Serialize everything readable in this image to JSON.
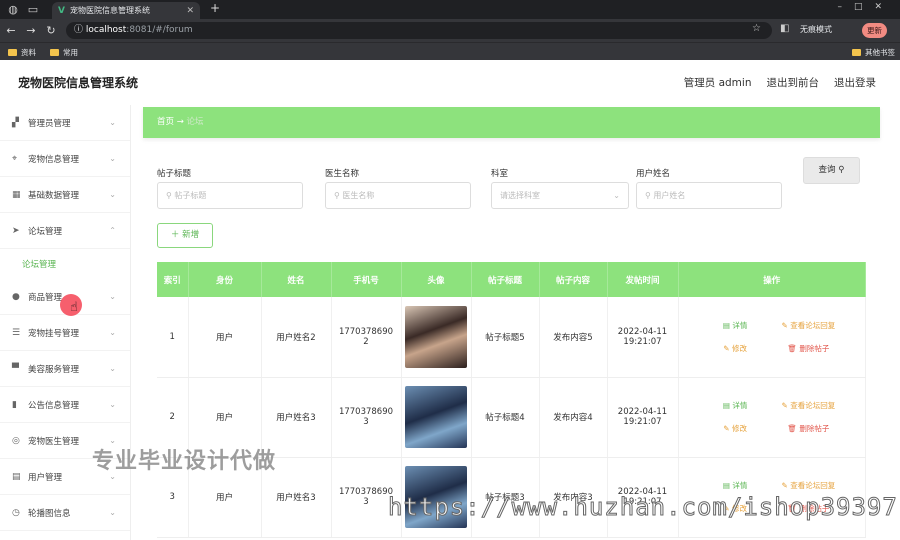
{
  "browser": {
    "tab_title": "宠物医院信息管理系统",
    "tab_favicon": "V",
    "url_host": "localhost",
    "url_path": ":8081/#/forum",
    "profile_label": "无痕模式",
    "update_label": "更新",
    "bookmarks": [
      "资料",
      "常用"
    ],
    "other_bookmarks": "其他书签"
  },
  "header": {
    "title": "宠物医院信息管理系统",
    "user": "管理员 admin",
    "back_front": "退出到前台",
    "logout": "退出登录"
  },
  "sidebar": {
    "items": [
      {
        "label": "管理员管理",
        "icon": "users-icon"
      },
      {
        "label": "宠物信息管理",
        "icon": "pet-icon"
      },
      {
        "label": "基础数据管理",
        "icon": "grid-icon"
      },
      {
        "label": "论坛管理",
        "icon": "send-icon"
      },
      {
        "label": "商品管理",
        "icon": "user-icon"
      },
      {
        "label": "宠物挂号管理",
        "icon": "list-icon"
      },
      {
        "label": "美容服务管理",
        "icon": "service-icon"
      },
      {
        "label": "公告信息管理",
        "icon": "bar-chart-icon"
      },
      {
        "label": "宠物医生管理",
        "icon": "compass-icon"
      },
      {
        "label": "用户管理",
        "icon": "id-card-icon"
      },
      {
        "label": "轮播图信息",
        "icon": "clock-icon"
      }
    ],
    "sub_item": "论坛管理"
  },
  "breadcrumb": {
    "home": "首页",
    "current": "论坛"
  },
  "filters": {
    "title_label": "帖子标题",
    "title_ph": "帖子标题",
    "doctor_label": "医生名称",
    "doctor_ph": "医生名称",
    "dept_label": "科室",
    "dept_ph": "请选择科室",
    "user_label": "用户姓名",
    "user_ph": "用户姓名",
    "query": "查询",
    "add": "新增"
  },
  "table": {
    "headers": [
      "索引",
      "身份",
      "姓名",
      "手机号",
      "头像",
      "帖子标题",
      "帖子内容",
      "发帖时间",
      "操作"
    ],
    "rows": [
      {
        "idx": "1",
        "role": "用户",
        "name": "用户姓名2",
        "phone": "17703786902",
        "title": "帖子标题5",
        "content": "发布内容5",
        "time": "2022-04-11 19:21:07"
      },
      {
        "idx": "2",
        "role": "用户",
        "name": "用户姓名3",
        "phone": "17703786903",
        "title": "帖子标题4",
        "content": "发布内容4",
        "time": "2022-04-11 19:21:07"
      },
      {
        "idx": "3",
        "role": "用户",
        "name": "用户姓名3",
        "phone": "17703786903",
        "title": "帖子标题3",
        "content": "发布内容3",
        "time": "2022-04-11 19:21:07"
      }
    ],
    "ops": {
      "detail": "详情",
      "view_reply": "查看论坛回复",
      "edit": "修改",
      "delete": "删除帖子"
    }
  },
  "watermarks": {
    "cn": "专业毕业设计代做",
    "url": "https://www.huzhan.com/ishop39397"
  }
}
